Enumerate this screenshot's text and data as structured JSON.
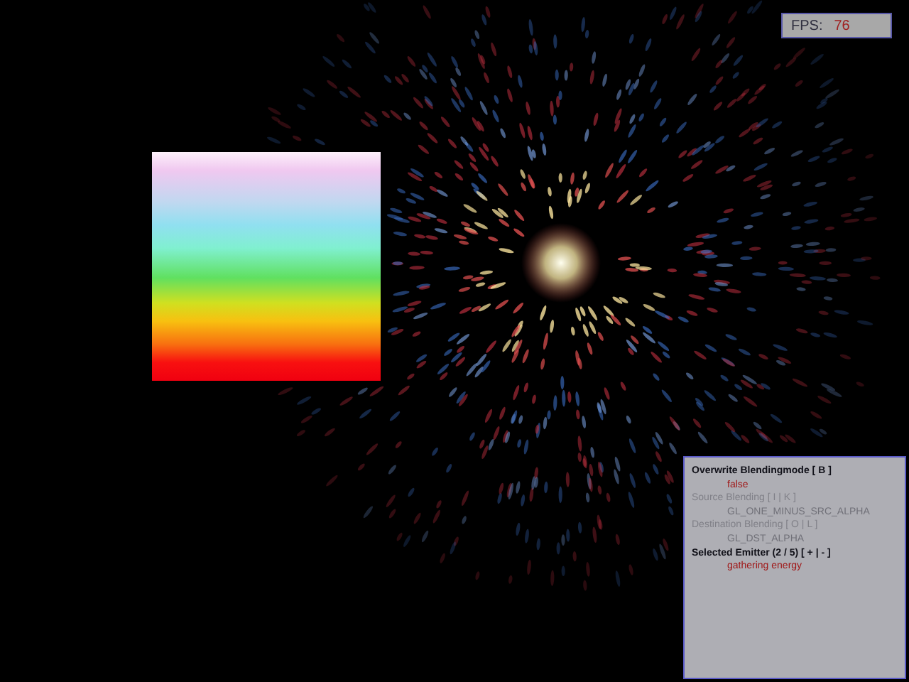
{
  "fps": {
    "label": "FPS:",
    "value": "76"
  },
  "settings": [
    {
      "label": "Overwrite Blendingmode [ B ]",
      "disabled": false,
      "value": "false"
    },
    {
      "label": "Source Blending [ I | K ]",
      "disabled": true,
      "value": "GL_ONE_MINUS_SRC_ALPHA"
    },
    {
      "label": "Destination Blending [ O | L ]",
      "disabled": true,
      "value": "GL_DST_ALPHA"
    },
    {
      "label": "Selected Emitter (2 / 5) [ + | - ]",
      "disabled": false,
      "value": "gathering energy"
    }
  ]
}
